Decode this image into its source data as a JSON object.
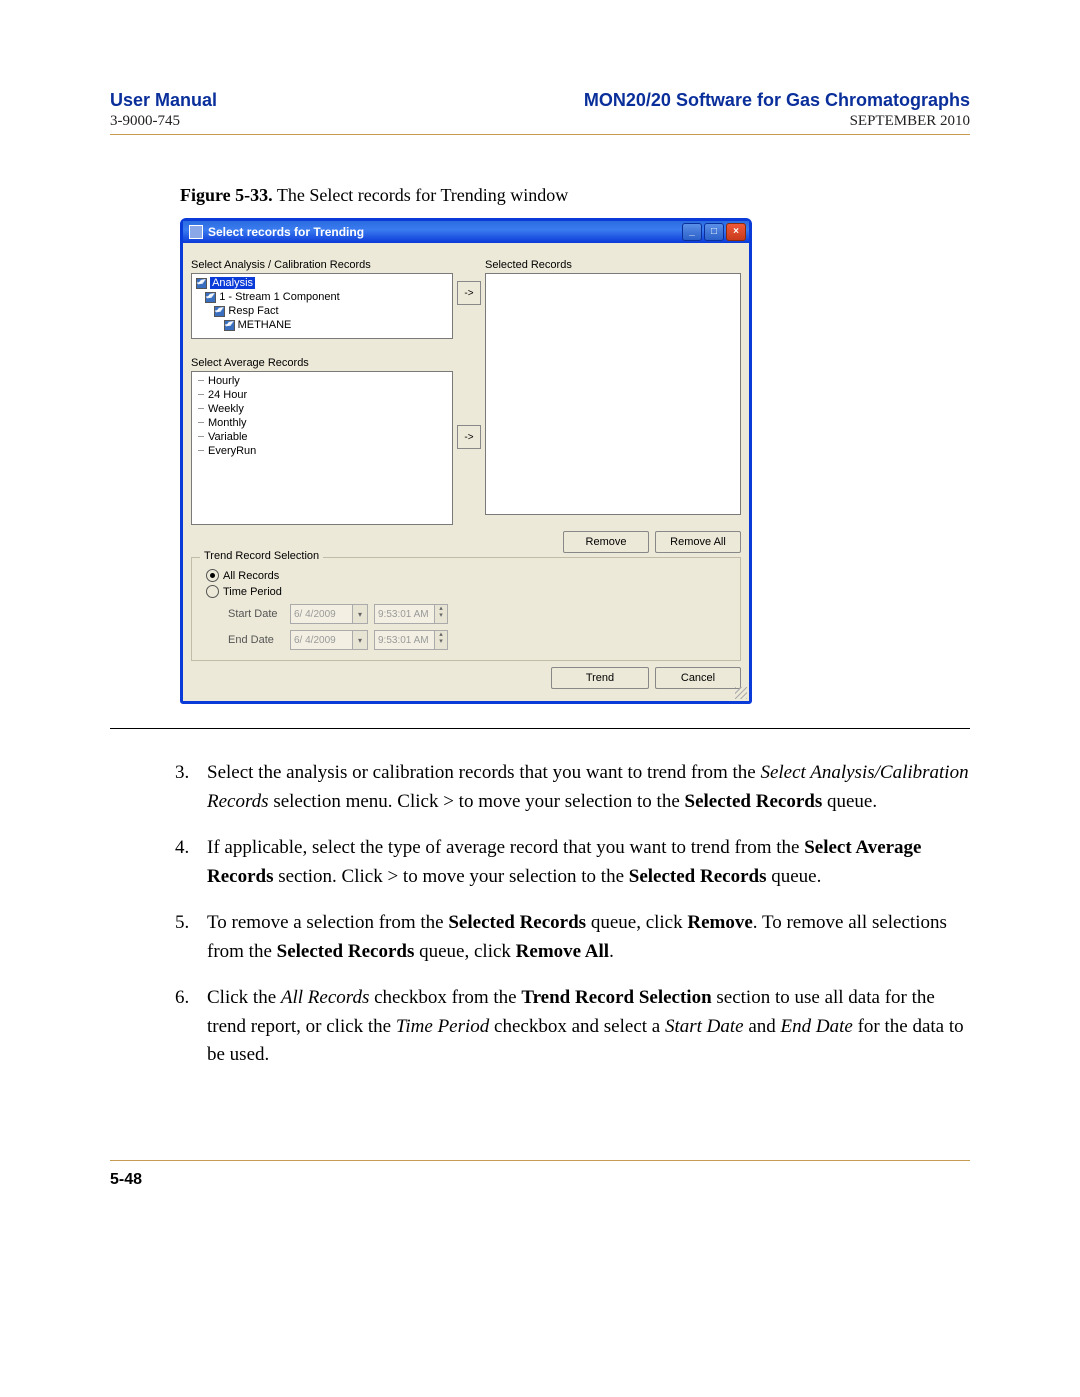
{
  "header": {
    "left_title": "User Manual",
    "right_title": "MON20/20 Software for Gas Chromatographs",
    "doc_number": "3-9000-745",
    "date": "SEPTEMBER 2010"
  },
  "figure": {
    "label": "Figure 5-33.",
    "caption": "The Select records for Trending window"
  },
  "window": {
    "title": "Select records for Trending",
    "labels": {
      "select_analysis": "Select Analysis / Calibration Records",
      "selected_records": "Selected Records",
      "select_average": "Select Average Records",
      "trend_group": "Trend Record Selection",
      "all_records": "All Records",
      "time_period": "Time Period",
      "start_date": "Start Date",
      "end_date": "End Date"
    },
    "tree": {
      "root": "Analysis",
      "l1": "1 - Stream 1 Component",
      "l2": "Resp Fact",
      "l3": "METHANE"
    },
    "avg_items": [
      "Hourly",
      "24 Hour",
      "Weekly",
      "Monthly",
      "Variable",
      "EveryRun"
    ],
    "arrow": "->",
    "buttons": {
      "remove": "Remove",
      "remove_all": "Remove All",
      "trend": "Trend",
      "cancel": "Cancel"
    },
    "date_value": "6/ 4/2009",
    "time_value": "9:53:01 AM",
    "winbtns": {
      "min": "_",
      "max": "□",
      "close": "×"
    }
  },
  "instructions": {
    "i3": {
      "n": "3.",
      "a": "Select the analysis or calibration records that you want to trend from the ",
      "i1": "Select Analysis/Calibration Records",
      "b": " selection menu.  Click > to move your selection to the ",
      "b1": "Selected Records",
      "c": " queue."
    },
    "i4": {
      "n": "4.",
      "a": "If applicable, select the type of average record that you want to trend from the ",
      "b1": "Select Average Records",
      "b": " section.  Click > to move your selection to the ",
      "b2": "Selected Records",
      "c": " queue."
    },
    "i5": {
      "n": "5.",
      "a": "To remove a selection from the ",
      "b1": "Selected Records",
      "b": " queue, click ",
      "b2": "Remove",
      "c": ".  To remove all selections from the ",
      "b3": "Selected Records",
      "d": " queue, click ",
      "b4": "Remove All",
      "e": "."
    },
    "i6": {
      "n": "6.",
      "a": "Click the ",
      "i1": "All Records",
      "b": " checkbox from the ",
      "b1": "Trend Record Selection",
      "c": " section to use all data for the trend report, or click the ",
      "i2": "Time Period",
      "d": " checkbox and select a ",
      "i3": "Start Date",
      "e": " and ",
      "i4": "End Date",
      "f": " for the data to be used."
    }
  },
  "page_number": "5-48"
}
